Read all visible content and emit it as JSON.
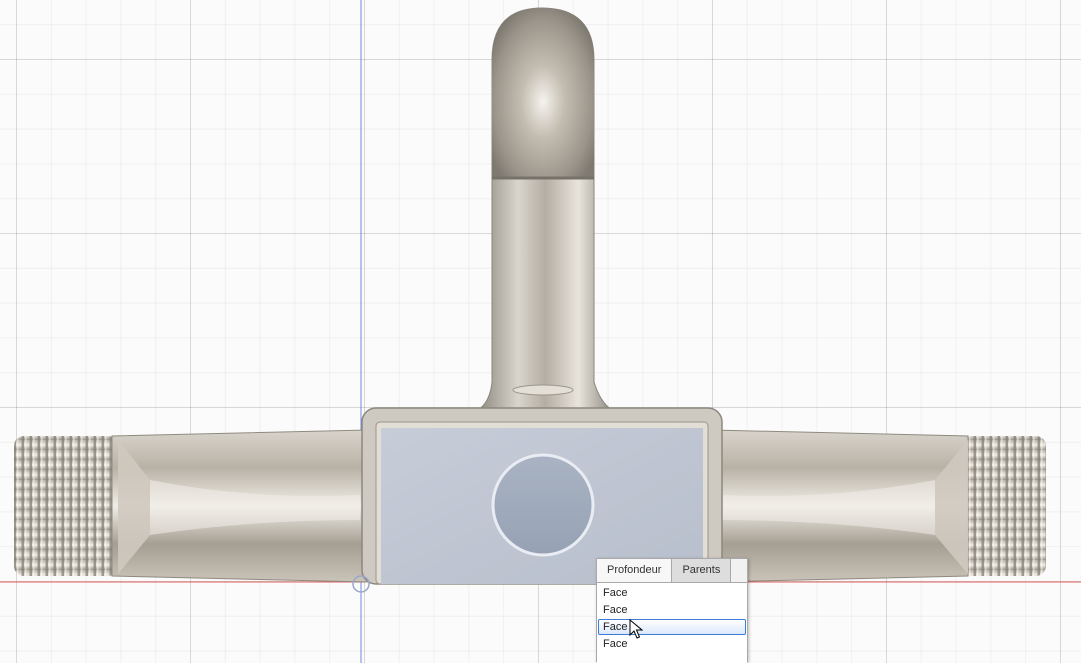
{
  "window": {
    "title": ""
  },
  "popup": {
    "tabs": [
      {
        "label": "Profondeur",
        "active": true
      },
      {
        "label": "Parents",
        "active": false
      }
    ],
    "items": [
      "Face",
      "Face",
      "Face",
      "Face"
    ],
    "selected_index": 2
  },
  "colors": {
    "accent": "#3d7bd6",
    "selected_face": "#c3cad6",
    "origin_x_axis": "#e06060",
    "origin_y_axis": "#6f88e0"
  },
  "icons": {
    "cursor": "arrow-pointer-icon"
  }
}
